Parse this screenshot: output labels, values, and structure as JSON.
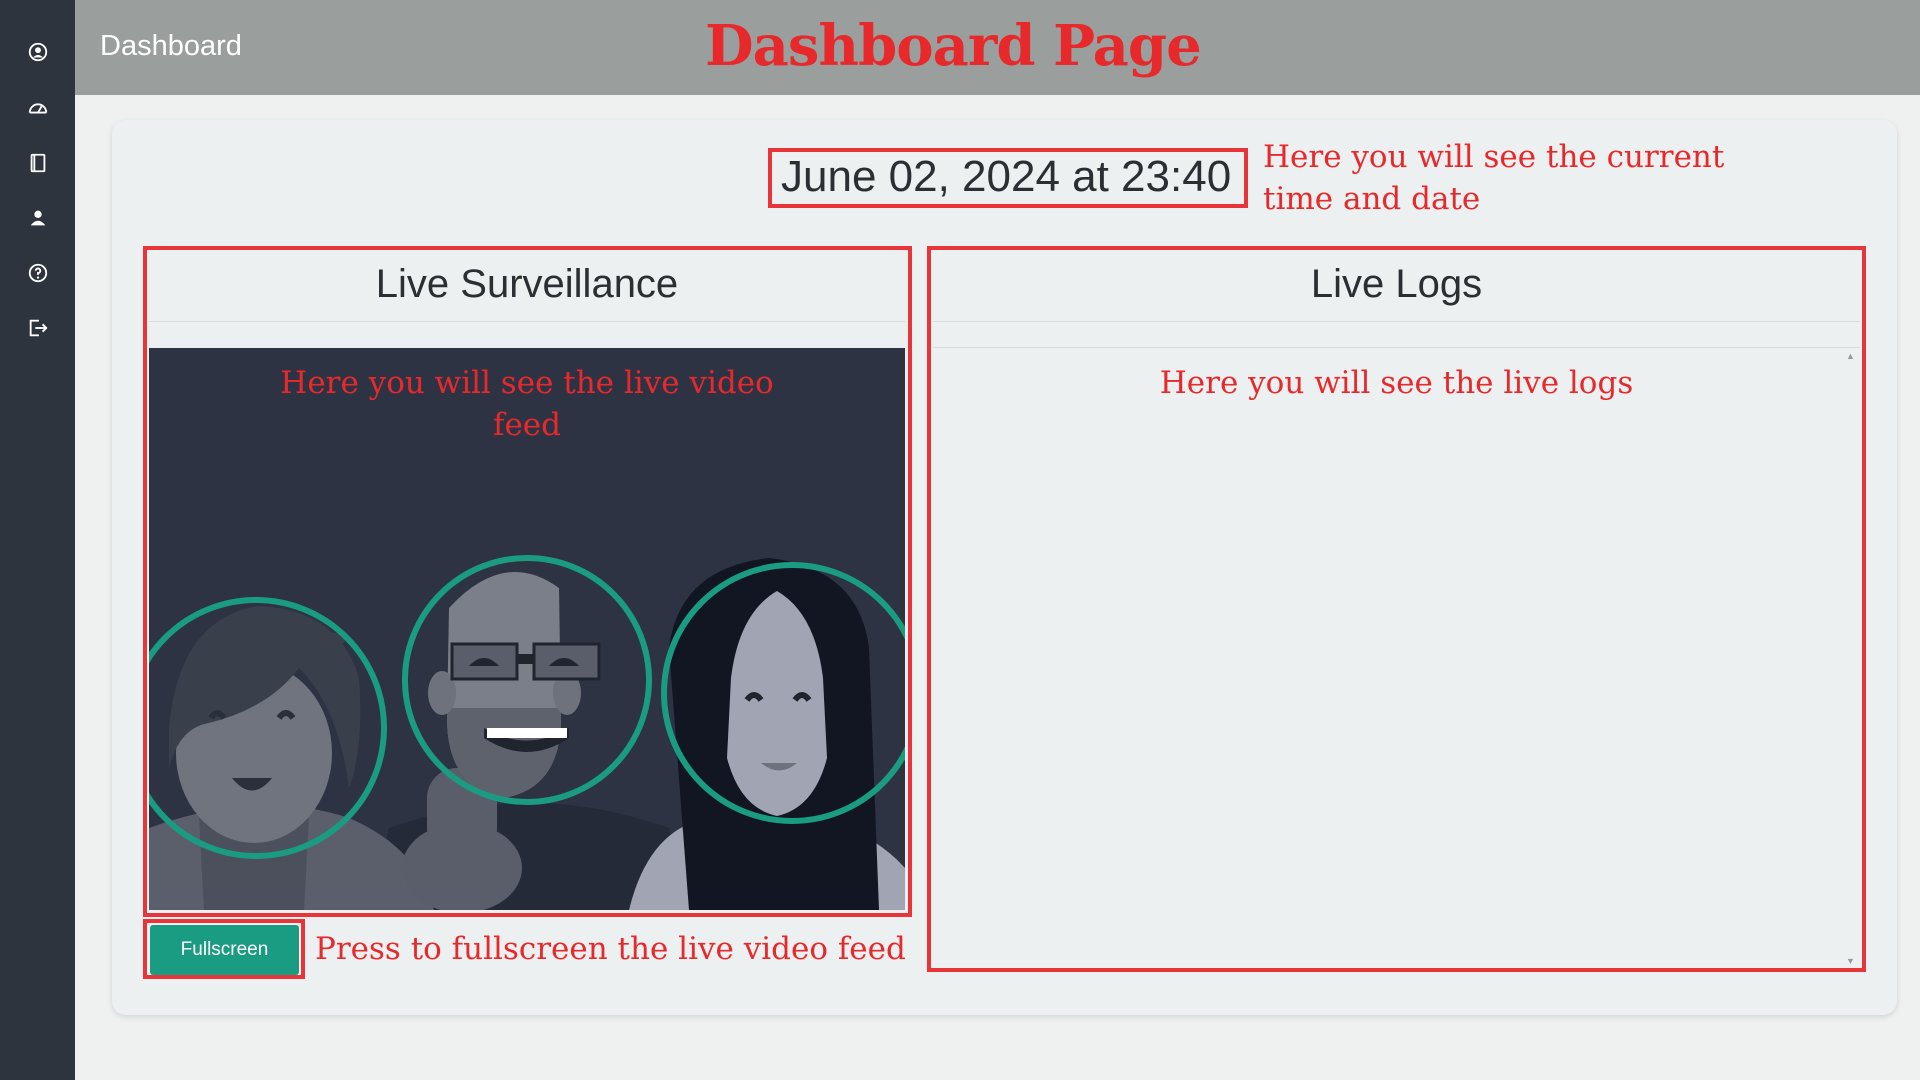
{
  "header": {
    "title": "Dashboard",
    "annotation_title": "Dashboard Page"
  },
  "sidebar": {
    "icons": [
      "user-circle-icon",
      "dashboard-gauge-icon",
      "book-icon",
      "user-icon",
      "help-icon",
      "logout-icon"
    ]
  },
  "datetime": {
    "text": "June 02, 2024 at 23:40",
    "annotation_line1": "Here you will see the current",
    "annotation_line2": "time and date"
  },
  "surveillance": {
    "title": "Live Surveillance",
    "annotation_line1": "Here you will see the live video",
    "annotation_line2": "feed"
  },
  "fullscreen": {
    "label": "Fullscreen",
    "annotation": "Press to fullscreen the live video feed"
  },
  "logs": {
    "title": "Live Logs",
    "annotation": "Here you will see the live logs"
  },
  "colors": {
    "sidebar": "#2e343e",
    "topbar": "#9a9f9d",
    "annotation_red": "#e8292c",
    "accent_teal": "#1a9c82",
    "video_bg": "#2e3344"
  }
}
